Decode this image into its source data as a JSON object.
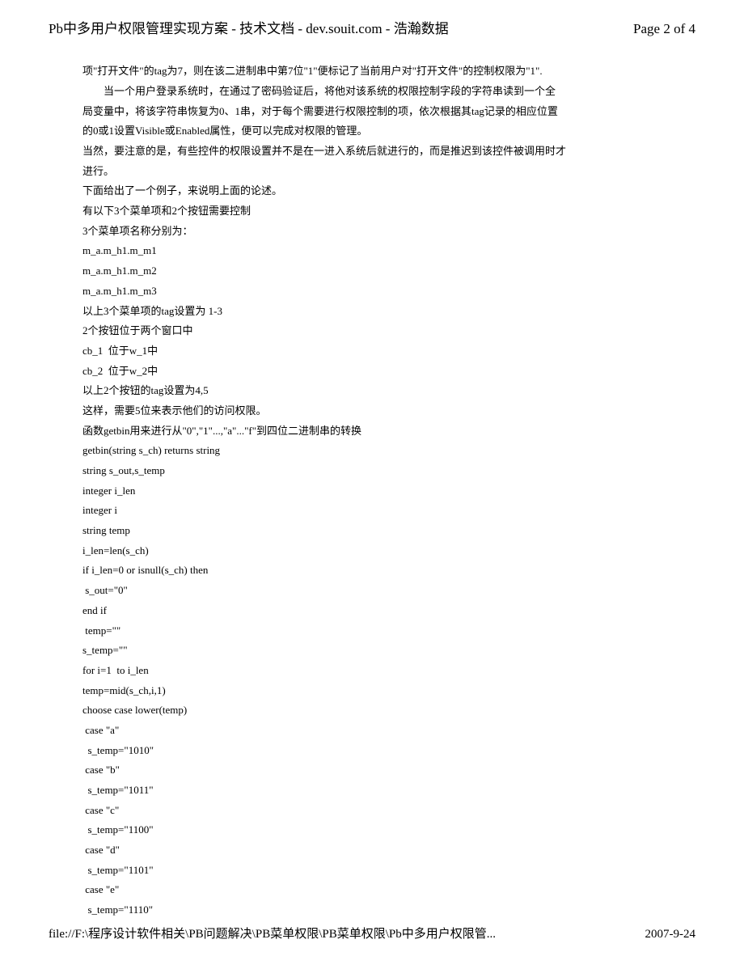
{
  "header": {
    "title": "Pb中多用户权限管理实现方案  - 技术文档  - dev.souit.com - 浩瀚数据",
    "pageno": "Page 2 of 4"
  },
  "body": {
    "lines": [
      "项\"打开文件\"的tag为7，则在该二进制串中第7位\"1\"便标记了当前用户对\"打开文件\"的控制权限为\"1\".",
      "        当一个用户登录系统时，在通过了密码验证后，将他对该系统的权限控制字段的字符串读到一个全",
      "局变量中，将该字符串恢复为0、1串，对于每个需要进行权限控制的项，依次根据其tag记录的相应位置",
      "的0或1设置Visible或Enabled属性，便可以完成对权限的管理。",
      "当然，要注意的是，有些控件的权限设置并不是在一进入系统后就进行的，而是推迟到该控件被调用时才",
      "进行。",
      "下面给出了一个例子，来说明上面的论述。",
      "有以下3个菜单项和2个按钮需要控制",
      "3个菜单项名称分别为：",
      "m_a.m_h1.m_m1",
      "m_a.m_h1.m_m2",
      "m_a.m_h1.m_m3",
      "以上3个菜单项的tag设置为 1-3",
      "2个按钮位于两个窗口中",
      "cb_1  位于w_1中",
      "cb_2  位于w_2中",
      "以上2个按钮的tag设置为4,5",
      "这样，需要5位来表示他们的访问权限。",
      "函数getbin用来进行从\"0\",\"1\"...,\"a\"...\"f\"到四位二进制串的转换",
      "getbin(string s_ch) returns string",
      "string s_out,s_temp",
      "integer i_len",
      "integer i",
      "string temp",
      "i_len=len(s_ch)",
      "if i_len=0 or isnull(s_ch) then",
      " s_out=\"0\"",
      "end if",
      " temp=\"\"",
      "s_temp=\"\"",
      "for i=1  to i_len",
      "temp=mid(s_ch,i,1)",
      "choose case lower(temp)",
      " case \"a\"",
      "  s_temp=\"1010\"",
      " case \"b\"",
      "  s_temp=\"1011\"",
      " case \"c\"",
      "  s_temp=\"1100\"",
      " case \"d\"",
      "  s_temp=\"1101\"",
      " case \"e\"",
      "  s_temp=\"1110\""
    ]
  },
  "footer": {
    "path": "file://F:\\程序设计软件相关\\PB问题解决\\PB菜单权限\\PB菜单权限\\Pb中多用户权限管...",
    "date": "2007-9-24"
  }
}
